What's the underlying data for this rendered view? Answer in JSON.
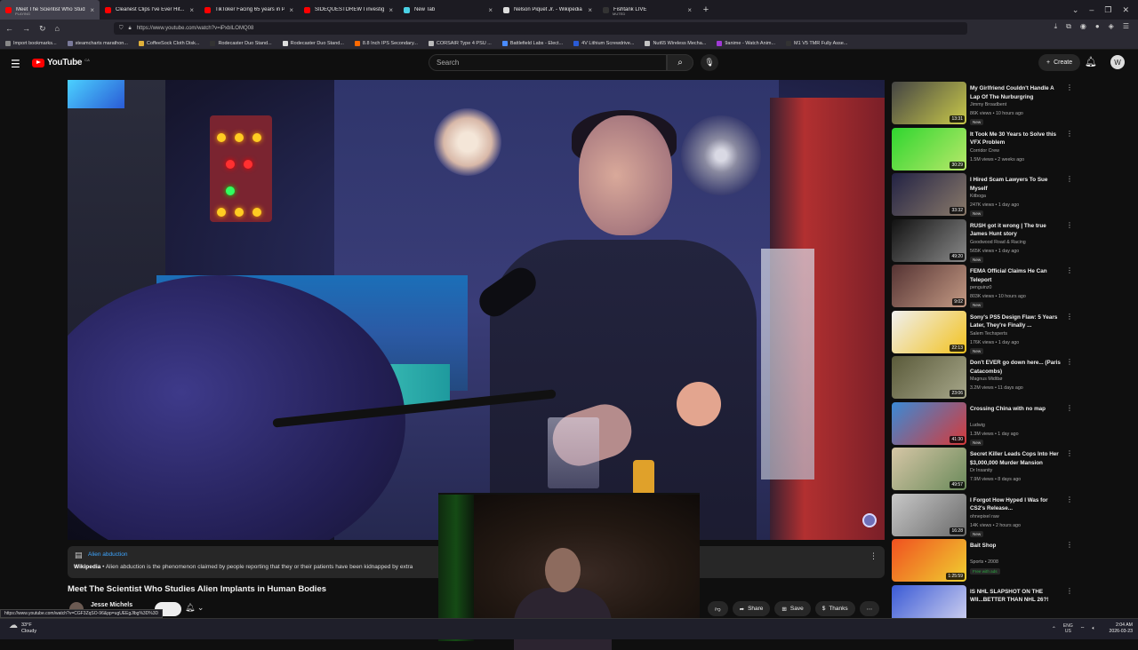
{
  "browser": {
    "tabs": [
      {
        "title": "Meet The Scientist Who Studie",
        "subtitle": "PLAYING",
        "color": "#ff0000",
        "active": true
      },
      {
        "title": "Cleanest Clips I've Ever Hit... (H",
        "color": "#ff0000"
      },
      {
        "title": "TikToker Facing 65 years in Pris",
        "color": "#ff0000"
      },
      {
        "title": "SIDEQUESTDREW I investigated",
        "color": "#ff0000"
      },
      {
        "title": "New Tab",
        "color": "#4ad1e5"
      },
      {
        "title": "Nelson Piquet Jr. - Wikipedia",
        "color": "#dddddd"
      },
      {
        "title": "Fishtank LIVE",
        "subtitle": "MUTED",
        "color": "#333333"
      }
    ],
    "url": "https://www.youtube.com/watch?v=iPxbILOMQ08",
    "url_host": "youtube.com",
    "bookmarks": [
      {
        "label": "Import bookmarks...",
        "color": "#888888"
      },
      {
        "label": "steamcharts marathon...",
        "color": "#7a7a9a"
      },
      {
        "label": "CoffeeSock Cloth Disk...",
        "color": "#e0b03a"
      },
      {
        "label": "Rodecaster Duo Stand...",
        "color": "#333333"
      },
      {
        "label": "Rodecaster Duo Stand...",
        "color": "#dddddd"
      },
      {
        "label": "8.8 Inch IPS Secondary...",
        "color": "#ff6a00"
      },
      {
        "label": "CORSAIR Type 4 PSU ...",
        "color": "#bbbbbb"
      },
      {
        "label": "Battlefield Labs - Elect...",
        "color": "#4a8cff"
      },
      {
        "label": "4V Lithium Screwdrive...",
        "color": "#2a5bd6"
      },
      {
        "label": "Nut65 Wireless Mecha...",
        "color": "#c4c4c4"
      },
      {
        "label": "9anime - Watch Anim...",
        "color": "#a03ad6"
      },
      {
        "label": "M1 V5 TMR Fully Asse...",
        "color": "#333333"
      }
    ]
  },
  "youtube": {
    "logo_text": "YouTube",
    "country_code": "CA",
    "search_placeholder": "Search",
    "create_label": "Create",
    "avatar_letter": "W"
  },
  "video": {
    "title": "Meet The Scientist Who Studies Alien Implants in Human Bodies",
    "channel": "Jesse Michels",
    "info_panel": {
      "title": "Alien abduction",
      "source": "Wikipedia",
      "description": "Alien abduction is the phenomenon claimed by people reporting that they or their patients have been kidnapped by extra"
    },
    "actions": [
      {
        "label": "Share",
        "icon": "share-icon",
        "glyph": "➦"
      },
      {
        "label": "Save",
        "icon": "save-icon",
        "glyph": "⊞"
      },
      {
        "label": "Thanks",
        "icon": "thanks-icon",
        "glyph": "$"
      }
    ]
  },
  "status_url": "https://www.youtube.com/watch?v=CGF3ZqSO-96&pp=ugUEEgJlbg%3D%3D",
  "recommendations": [
    {
      "title": "My Girlfriend Couldn't Handle A Lap Of The Nurburgring",
      "channel": "Jimmy Broadbent",
      "meta": "86K views • 10 hours ago",
      "badge": "New",
      "duration": "13:31",
      "c1": "#444444",
      "c2": "#c9c94a"
    },
    {
      "title": "It Took Me 30 Years to Solve this VFX Problem",
      "channel": "Corridor Crew",
      "meta": "1.5M views • 2 weeks ago",
      "badge": "",
      "duration": "30:29",
      "c1": "#2fd62f",
      "c2": "#b8e86a"
    },
    {
      "title": "I Hired Scam Lawyers To Sue Myself",
      "channel": "Kitboga",
      "meta": "247K views • 1 day ago",
      "badge": "New",
      "duration": "33:32",
      "c1": "#222244",
      "c2": "#8a7a6a"
    },
    {
      "title": "RUSH got it wrong | The true James Hunt story",
      "channel": "Goodwood Road & Racing",
      "meta": "565K views • 1 day ago",
      "badge": "New",
      "duration": "49:20",
      "c1": "#111111",
      "c2": "#8a8a8a"
    },
    {
      "title": "FEMA Official Claims He Can Teleport",
      "channel": "penguinz0",
      "meta": "803K views • 10 hours ago",
      "badge": "New",
      "duration": "9:02",
      "c1": "#553333",
      "c2": "#c49a84"
    },
    {
      "title": "Sony's PS5 Design Flaw: 5 Years Later, They're Finally ...",
      "channel": "Salem Techsperts",
      "meta": "176K views • 1 day ago",
      "badge": "New",
      "duration": "22:13",
      "c1": "#f0f0f0",
      "c2": "#f2c21f"
    },
    {
      "title": "Don't EVER go down here... (Paris Catacombs)",
      "channel": "Magnus Midtbø",
      "meta": "3.2M views • 11 days ago",
      "badge": "",
      "duration": "23:06",
      "c1": "#5a5a3a",
      "c2": "#a7a78a"
    },
    {
      "title": "Crossing China with no map",
      "channel": "Ludwig",
      "meta": "1.3M views • 1 day ago",
      "badge": "New",
      "duration": "41:30",
      "c1": "#3a8ad6",
      "c2": "#d63a3a"
    },
    {
      "title": "Secret Killer Leads Cops Into Her $3,000,000 Murder Mansion",
      "channel": "Dr Insanity",
      "meta": "7.9M views • 8 days ago",
      "badge": "",
      "duration": "49:57",
      "c1": "#d6c6a6",
      "c2": "#6a8a5a"
    },
    {
      "title": "I Forgot How Hyped I Was for CS2's Release...",
      "channel": "ohnepixel raw",
      "meta": "14K views • 2 hours ago",
      "badge": "New",
      "duration": "16:28",
      "c1": "#c8c8c8",
      "c2": "#6a6a6a"
    },
    {
      "title": "Bait Shop",
      "channel": "Sports • 2008",
      "meta": "",
      "badge": "Free with ads",
      "badge_green": true,
      "duration": "1:25:59",
      "c1": "#f05020",
      "c2": "#f0d030"
    },
    {
      "title": "IS NHL SLAPSHOT ON THE WII...BETTER THAN NHL 26?!",
      "channel": "",
      "meta": "",
      "badge": "",
      "duration": "",
      "c1": "#3a5ad6",
      "c2": "#d6d6f0"
    }
  ],
  "taskbar": {
    "temperature": "33°F",
    "condition": "Cloudy",
    "lang_top": "ENG",
    "lang_bottom": "US",
    "time": "2:04 AM",
    "date": "2026-03-23"
  }
}
